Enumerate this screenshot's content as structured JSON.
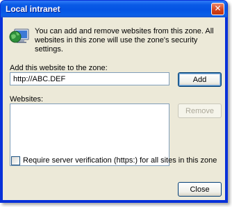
{
  "window": {
    "title": "Local intranet",
    "close_glyph": "✕"
  },
  "intro": {
    "icon": "intranet-globe-computer-icon",
    "text": "You can add and remove websites from this zone. All websites in this zone will use the zone's security settings."
  },
  "add_site": {
    "label": "Add this website to the zone:",
    "value": "http://ABC.DEF",
    "button_label": "Add"
  },
  "websites": {
    "label": "Websites:",
    "items": [],
    "remove_label": "Remove"
  },
  "verification": {
    "label": "Require server verification (https:) for all sites in this zone",
    "checked": false
  },
  "footer": {
    "close_label": "Close"
  }
}
